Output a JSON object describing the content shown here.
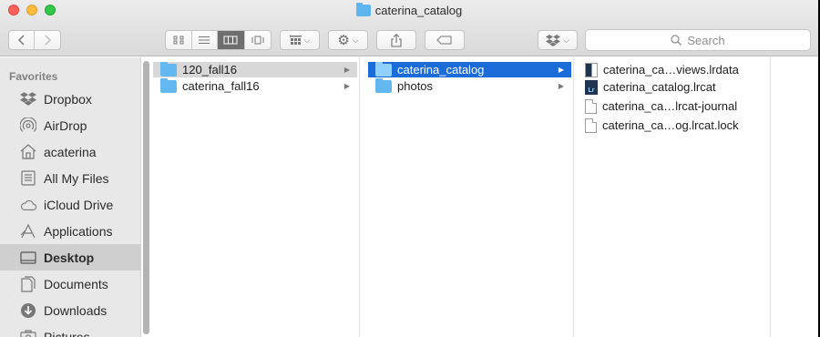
{
  "window": {
    "title": "caterina_catalog"
  },
  "toolbar": {
    "back_icon": "chevron-left-icon",
    "forward_icon": "chevron-right-icon",
    "view_icons": [
      "icon-view-icon",
      "list-view-icon",
      "column-view-icon",
      "cover-flow-icon"
    ],
    "active_view": "column-view",
    "arrange_icon": "arrange-grid-icon",
    "action_icon": "gear-icon",
    "share_icon": "share-icon",
    "tags_icon": "tag-icon",
    "dropbox_icon": "dropbox-icon",
    "search_placeholder": "Search"
  },
  "sidebar": {
    "heading": "Favorites",
    "items": [
      {
        "label": "Dropbox",
        "icon": "dropbox-icon"
      },
      {
        "label": "AirDrop",
        "icon": "airdrop-icon"
      },
      {
        "label": "acaterina",
        "icon": "home-icon"
      },
      {
        "label": "All My Files",
        "icon": "all-files-icon"
      },
      {
        "label": "iCloud Drive",
        "icon": "cloud-icon"
      },
      {
        "label": "Applications",
        "icon": "applications-icon"
      },
      {
        "label": "Desktop",
        "icon": "desktop-icon",
        "selected": true
      },
      {
        "label": "Documents",
        "icon": "documents-icon"
      },
      {
        "label": "Downloads",
        "icon": "downloads-icon"
      },
      {
        "label": "Pictures",
        "icon": "pictures-icon"
      }
    ]
  },
  "columns": [
    {
      "items": [
        {
          "label": "120_fall16",
          "type": "folder",
          "selected": "inactive"
        },
        {
          "label": "caterina_fall16",
          "type": "folder"
        }
      ]
    },
    {
      "items": [
        {
          "label": "caterina_catalog",
          "type": "folder",
          "selected": "active"
        },
        {
          "label": "photos",
          "type": "folder"
        }
      ]
    },
    {
      "items": [
        {
          "label": "caterina_ca…views.lrdata",
          "type": "lrdata"
        },
        {
          "label": "caterina_catalog.lrcat",
          "type": "lrcat"
        },
        {
          "label": "caterina_ca…lrcat-journal",
          "type": "document"
        },
        {
          "label": "caterina_ca…og.lrcat.lock",
          "type": "document"
        }
      ]
    }
  ],
  "colors": {
    "selection_blue": "#1b6bd9",
    "folder_blue": "#64b8f0",
    "sidebar_bg": "#e8e8e8"
  }
}
